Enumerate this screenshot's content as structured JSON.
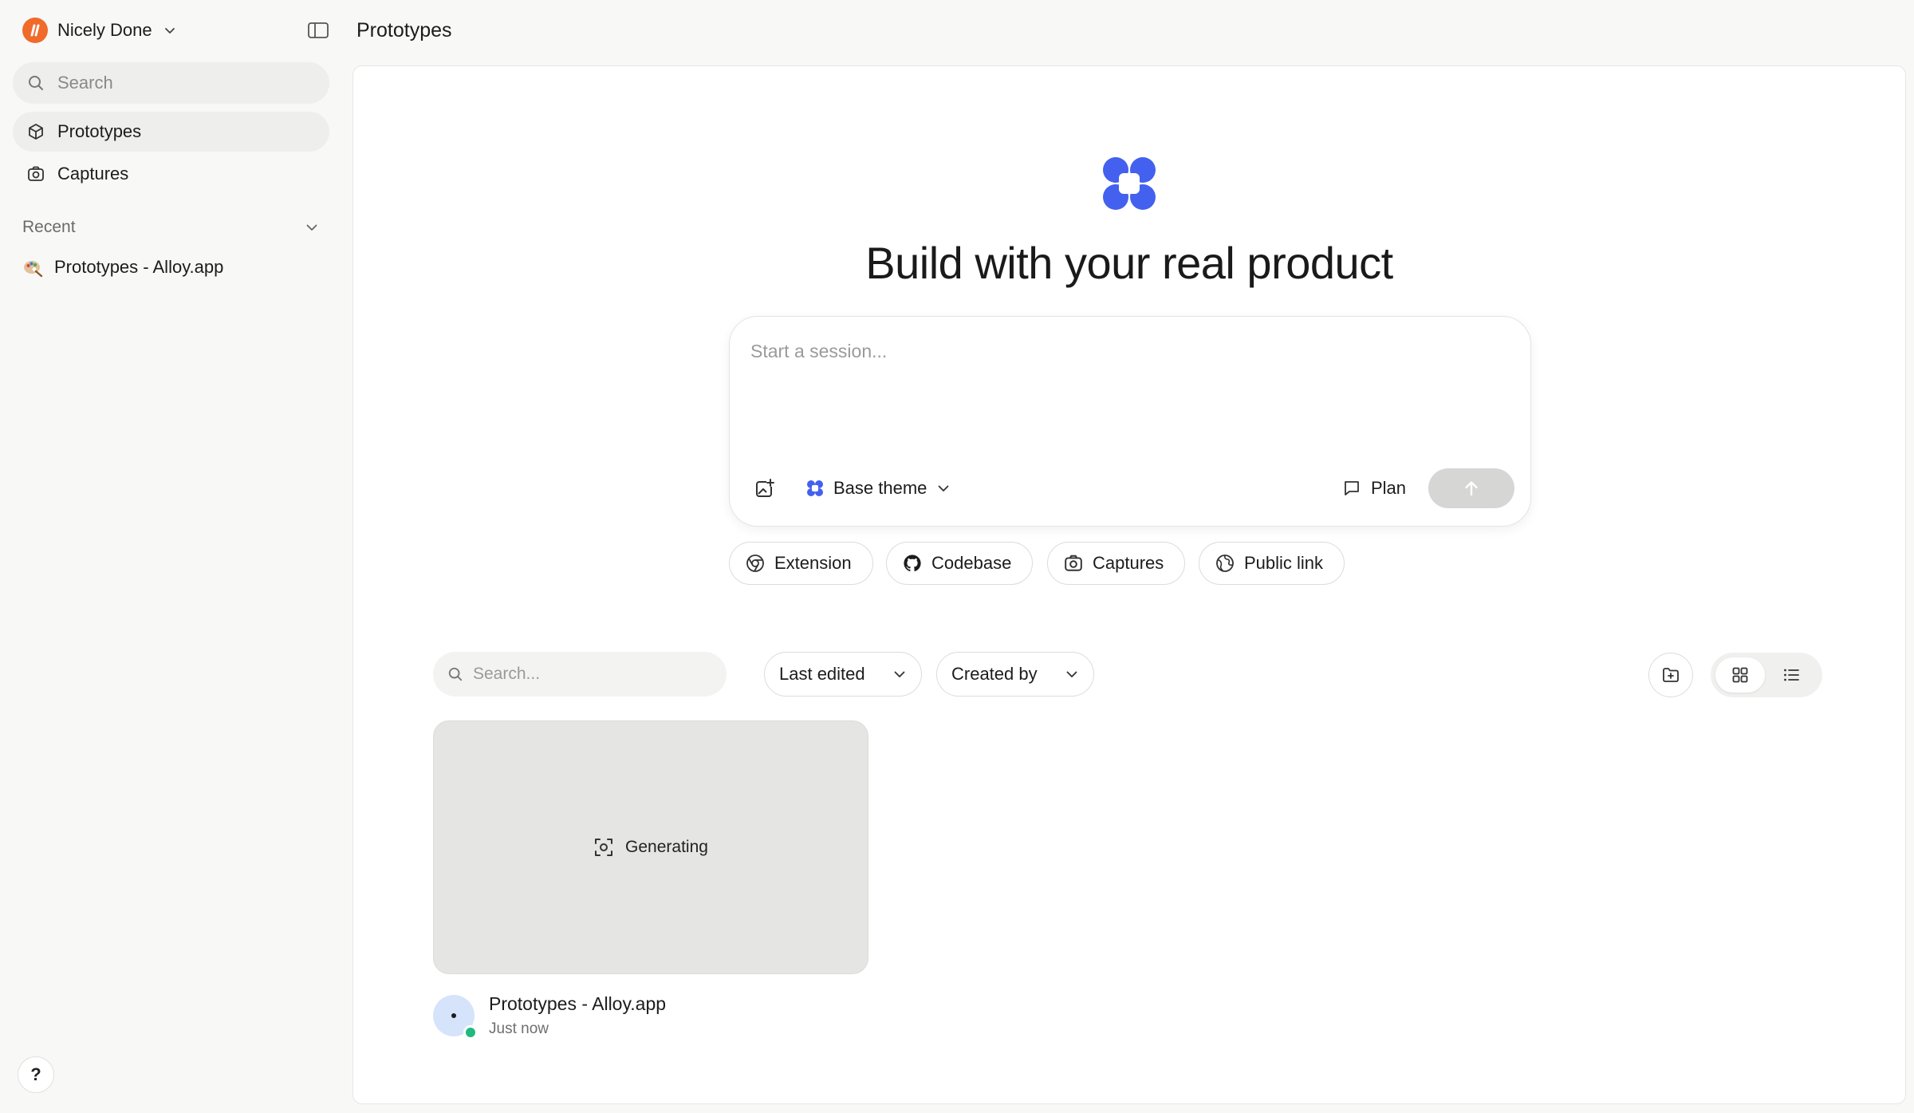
{
  "sidebar": {
    "workspace": {
      "name": "Nicely Done",
      "logo_color": "#f06a2a"
    },
    "search_placeholder": "Search",
    "nav": [
      {
        "label": "Prototypes",
        "icon": "cube-icon",
        "active": true
      },
      {
        "label": "Captures",
        "icon": "camera-icon",
        "active": false
      }
    ],
    "recent": {
      "label": "Recent",
      "items": [
        {
          "label": "Prototypes - Alloy.app",
          "icon": "palette-icon"
        }
      ]
    },
    "help_label": "?"
  },
  "header": {
    "title": "Prototypes"
  },
  "hero": {
    "title": "Build with your real product",
    "logo_color": "#4361ee"
  },
  "prompt": {
    "placeholder": "Start a session...",
    "theme_label": "Base theme",
    "plan_label": "Plan"
  },
  "chips": [
    {
      "label": "Extension",
      "icon": "chrome-icon"
    },
    {
      "label": "Codebase",
      "icon": "github-icon"
    },
    {
      "label": "Captures",
      "icon": "camera-icon"
    },
    {
      "label": "Public link",
      "icon": "globe-icon"
    }
  ],
  "toolbar": {
    "search_placeholder": "Search...",
    "sort_label": "Last edited",
    "filter_label": "Created by",
    "view_mode": "grid"
  },
  "cards": [
    {
      "status_label": "Generating",
      "title": "Prototypes - Alloy.app",
      "subtitle": "Just now",
      "status_color": "#1fba7d"
    }
  ]
}
